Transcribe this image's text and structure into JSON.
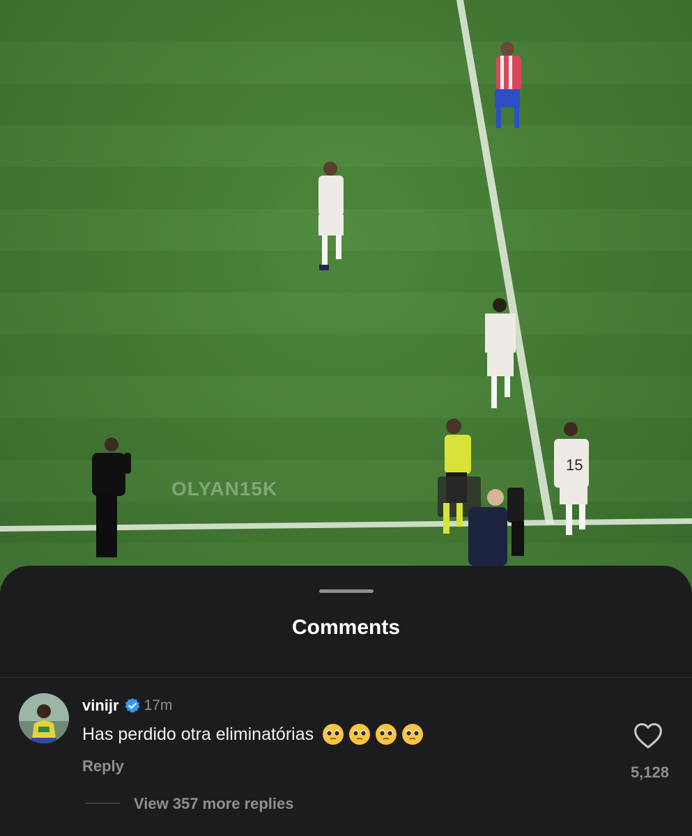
{
  "video": {
    "watermark": "OLYAN15K",
    "shirt_number": "15",
    "colors": {
      "pitch": "#437a33",
      "line": "#e8efe2"
    }
  },
  "sheet": {
    "title": "Comments"
  },
  "comment": {
    "username": "vinijr",
    "verified_icon": "verified-badge-icon",
    "time": "17m",
    "text": "Has perdido otra eliminatórias",
    "emoji_name": "pleading-face-emoji",
    "emoji_count": 4,
    "reply_label": "Reply",
    "like_icon": "heart-icon",
    "likes": "5,128",
    "view_replies": "View 357 more replies"
  },
  "colors": {
    "sheet_bg": "#1c1c1e",
    "verified_blue": "#3797f0",
    "secondary_text": "#8e8e93"
  }
}
